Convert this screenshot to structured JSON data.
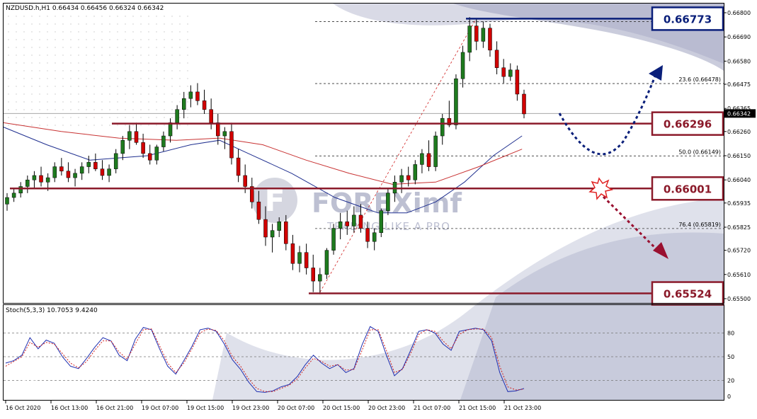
{
  "symbol_header": "NZDUSD.h,H1  0.66434 0.66456 0.66324 0.66342",
  "stoch_header": "Stoch(5,3,3) 10.7053 9.4240",
  "watermark": {
    "brand": "FOREXimf",
    "tagline": "TRADING LIKE A PRO"
  },
  "colors": {
    "bull": "#1e7a1e",
    "bear": "#d10000",
    "ma_fast": "#1f2f8f",
    "ma_slow": "#c83232",
    "level_red": "#8b1a2a",
    "level_blue": "#0a1f7a",
    "band": "#b9bcd2",
    "stoch_main": "#1f2fb0",
    "stoch_signal": "#d02020"
  },
  "chart_data": [
    {
      "type": "candlestick",
      "ylim": [
        0.655,
        0.668
      ],
      "y_ticks": [
        "0.66800",
        "0.66690",
        "0.66580",
        "0.66475",
        "0.66365",
        "0.66260",
        "0.66150",
        "0.66040",
        "0.65935",
        "0.65825",
        "0.65720",
        "0.65610",
        "0.65500"
      ],
      "current_price": "0.66342",
      "x_labels": [
        "16 Oct 2020",
        "16 Oct 13:00",
        "16 Oct 21:00",
        "19 Oct 07:00",
        "19 Oct 15:00",
        "19 Oct 23:00",
        "20 Oct 07:00",
        "20 Oct 15:00",
        "20 Oct 23:00",
        "21 Oct 07:00",
        "21 Oct 15:00",
        "21 Oct 23:00"
      ],
      "levels": [
        {
          "label": "0.66773",
          "value": 0.66773,
          "style": "blue",
          "from": 0.6
        },
        {
          "label": "0.66296",
          "value": 0.66296,
          "style": "red",
          "from": 0.14
        },
        {
          "label": "0.66001",
          "value": 0.66001,
          "style": "red",
          "from": 0.0
        },
        {
          "label": "0.65524",
          "value": 0.65524,
          "style": "red",
          "from": 0.4
        }
      ],
      "fib_levels": [
        {
          "label": "23.6 (0.66478)",
          "value": 0.66478
        },
        {
          "label": "50.0 (0.66149)",
          "value": 0.66149
        },
        {
          "label": "76.4 (0.65819)",
          "value": 0.65819
        }
      ],
      "fib_top": 0.6676,
      "candles": [
        [
          0.6593,
          0.6598,
          0.659,
          0.6596
        ],
        [
          0.6596,
          0.66,
          0.6594,
          0.6598
        ],
        [
          0.6598,
          0.6603,
          0.6596,
          0.6601
        ],
        [
          0.6601,
          0.6606,
          0.6598,
          0.6604
        ],
        [
          0.6604,
          0.6608,
          0.66,
          0.6606
        ],
        [
          0.6606,
          0.661,
          0.6601,
          0.6603
        ],
        [
          0.6603,
          0.6607,
          0.6599,
          0.6605
        ],
        [
          0.6605,
          0.6612,
          0.6603,
          0.661
        ],
        [
          0.661,
          0.6614,
          0.6606,
          0.6608
        ],
        [
          0.6608,
          0.6612,
          0.6603,
          0.6605
        ],
        [
          0.6605,
          0.6609,
          0.6601,
          0.6607
        ],
        [
          0.6607,
          0.6612,
          0.6604,
          0.661
        ],
        [
          0.661,
          0.6615,
          0.6607,
          0.6612
        ],
        [
          0.6612,
          0.6616,
          0.6608,
          0.6609
        ],
        [
          0.6609,
          0.6613,
          0.6604,
          0.6606
        ],
        [
          0.6606,
          0.6611,
          0.6603,
          0.6609
        ],
        [
          0.6609,
          0.6618,
          0.6607,
          0.6616
        ],
        [
          0.6616,
          0.6624,
          0.6613,
          0.6622
        ],
        [
          0.6622,
          0.6629,
          0.6618,
          0.6626
        ],
        [
          0.6626,
          0.663,
          0.662,
          0.6621
        ],
        [
          0.6621,
          0.6625,
          0.6614,
          0.6616
        ],
        [
          0.6616,
          0.662,
          0.6611,
          0.6613
        ],
        [
          0.6613,
          0.662,
          0.6611,
          0.6619
        ],
        [
          0.6619,
          0.6626,
          0.6617,
          0.6624
        ],
        [
          0.6624,
          0.6632,
          0.6621,
          0.663
        ],
        [
          0.663,
          0.6638,
          0.6627,
          0.6636
        ],
        [
          0.6636,
          0.6644,
          0.6632,
          0.6641
        ],
        [
          0.6641,
          0.6647,
          0.6637,
          0.6644
        ],
        [
          0.6644,
          0.6648,
          0.6638,
          0.664
        ],
        [
          0.664,
          0.6645,
          0.6634,
          0.6636
        ],
        [
          0.6636,
          0.6641,
          0.6627,
          0.663
        ],
        [
          0.663,
          0.6634,
          0.662,
          0.6624
        ],
        [
          0.6624,
          0.6628,
          0.6618,
          0.6626
        ],
        [
          0.6626,
          0.663,
          0.6611,
          0.6614
        ],
        [
          0.6614,
          0.6618,
          0.6603,
          0.6606
        ],
        [
          0.6606,
          0.6611,
          0.6598,
          0.6601
        ],
        [
          0.6601,
          0.6605,
          0.6591,
          0.6594
        ],
        [
          0.6594,
          0.6599,
          0.6584,
          0.6586
        ],
        [
          0.6586,
          0.6592,
          0.6574,
          0.6578
        ],
        [
          0.6578,
          0.6584,
          0.6571,
          0.6581
        ],
        [
          0.6581,
          0.6587,
          0.6578,
          0.6585
        ],
        [
          0.6585,
          0.6588,
          0.6572,
          0.6575
        ],
        [
          0.6575,
          0.6579,
          0.6563,
          0.6566
        ],
        [
          0.6566,
          0.6574,
          0.6562,
          0.6571
        ],
        [
          0.6571,
          0.6575,
          0.6561,
          0.6564
        ],
        [
          0.6564,
          0.657,
          0.6553,
          0.6558
        ],
        [
          0.6558,
          0.6564,
          0.6552,
          0.6561
        ],
        [
          0.6561,
          0.6573,
          0.6559,
          0.6572
        ],
        [
          0.6572,
          0.6584,
          0.657,
          0.6582
        ],
        [
          0.6582,
          0.6589,
          0.6577,
          0.6585
        ],
        [
          0.6585,
          0.659,
          0.6579,
          0.6583
        ],
        [
          0.6583,
          0.6592,
          0.658,
          0.6588
        ],
        [
          0.6588,
          0.6593,
          0.658,
          0.6582
        ],
        [
          0.6582,
          0.6585,
          0.6573,
          0.6576
        ],
        [
          0.6576,
          0.6582,
          0.6572,
          0.658
        ],
        [
          0.658,
          0.6591,
          0.6578,
          0.659
        ],
        [
          0.659,
          0.66,
          0.6588,
          0.6598
        ],
        [
          0.6598,
          0.6606,
          0.6594,
          0.6603
        ],
        [
          0.6603,
          0.6609,
          0.6598,
          0.6606
        ],
        [
          0.6606,
          0.661,
          0.6601,
          0.6604
        ],
        [
          0.6604,
          0.6613,
          0.6602,
          0.6611
        ],
        [
          0.6611,
          0.6618,
          0.6607,
          0.6616
        ],
        [
          0.6616,
          0.6622,
          0.6608,
          0.661
        ],
        [
          0.661,
          0.6626,
          0.6608,
          0.6624
        ],
        [
          0.6624,
          0.6634,
          0.662,
          0.6632
        ],
        [
          0.6632,
          0.664,
          0.6628,
          0.6629
        ],
        [
          0.6629,
          0.6652,
          0.6627,
          0.665
        ],
        [
          0.665,
          0.6665,
          0.6646,
          0.6662
        ],
        [
          0.6662,
          0.6678,
          0.6658,
          0.6674
        ],
        [
          0.6674,
          0.6677,
          0.6663,
          0.6667
        ],
        [
          0.6667,
          0.6676,
          0.6664,
          0.6673
        ],
        [
          0.6673,
          0.6675,
          0.666,
          0.6663
        ],
        [
          0.6663,
          0.6667,
          0.6652,
          0.6655
        ],
        [
          0.6655,
          0.6659,
          0.6648,
          0.6651
        ],
        [
          0.6651,
          0.6657,
          0.6649,
          0.6654
        ],
        [
          0.6654,
          0.6656,
          0.664,
          0.6643
        ],
        [
          0.6643,
          0.6645,
          0.6632,
          0.6634
        ]
      ],
      "ma_fast": [
        [
          0,
          0.6628
        ],
        [
          0.06,
          0.662
        ],
        [
          0.12,
          0.6613
        ],
        [
          0.2,
          0.6615
        ],
        [
          0.26,
          0.662
        ],
        [
          0.3,
          0.6622
        ],
        [
          0.34,
          0.6616
        ],
        [
          0.4,
          0.6607
        ],
        [
          0.46,
          0.6596
        ],
        [
          0.52,
          0.6589
        ],
        [
          0.56,
          0.6589
        ],
        [
          0.6,
          0.6594
        ],
        [
          0.64,
          0.6603
        ],
        [
          0.68,
          0.6615
        ],
        [
          0.72,
          0.6624
        ]
      ],
      "ma_slow": [
        [
          0,
          0.663
        ],
        [
          0.08,
          0.6626
        ],
        [
          0.16,
          0.6623
        ],
        [
          0.24,
          0.6622
        ],
        [
          0.3,
          0.6623
        ],
        [
          0.36,
          0.662
        ],
        [
          0.42,
          0.6613
        ],
        [
          0.48,
          0.6607
        ],
        [
          0.54,
          0.6602
        ],
        [
          0.6,
          0.6603
        ],
        [
          0.66,
          0.661
        ],
        [
          0.72,
          0.6618
        ]
      ]
    },
    {
      "type": "line",
      "ylim": [
        0,
        100
      ],
      "y_ticks": [
        "80",
        "50",
        "20",
        "0"
      ],
      "series": [
        {
          "values": [
            42,
            45,
            52,
            74,
            60,
            71,
            67,
            50,
            38,
            35,
            48,
            62,
            74,
            70,
            52,
            45,
            72,
            87,
            84,
            60,
            38,
            28,
            45,
            63,
            84,
            86,
            82,
            66,
            46,
            34,
            18,
            6,
            5,
            7,
            12,
            15,
            25,
            40,
            52,
            42,
            35,
            40,
            30,
            35,
            65,
            88,
            82,
            52,
            26,
            35,
            58,
            82,
            84,
            80,
            66,
            58,
            82,
            84,
            86,
            84,
            70,
            30,
            6,
            7,
            10
          ]
        },
        {
          "values": [
            38,
            44,
            50,
            68,
            62,
            68,
            66,
            54,
            42,
            36,
            44,
            58,
            70,
            70,
            56,
            47,
            66,
            84,
            85,
            64,
            42,
            30,
            42,
            60,
            80,
            85,
            83,
            70,
            50,
            38,
            22,
            10,
            6,
            6,
            10,
            14,
            22,
            36,
            48,
            44,
            38,
            40,
            33,
            34,
            58,
            84,
            84,
            58,
            30,
            34,
            54,
            78,
            84,
            82,
            70,
            60,
            78,
            84,
            85,
            85,
            74,
            38,
            12,
            8,
            9
          ]
        }
      ]
    }
  ]
}
